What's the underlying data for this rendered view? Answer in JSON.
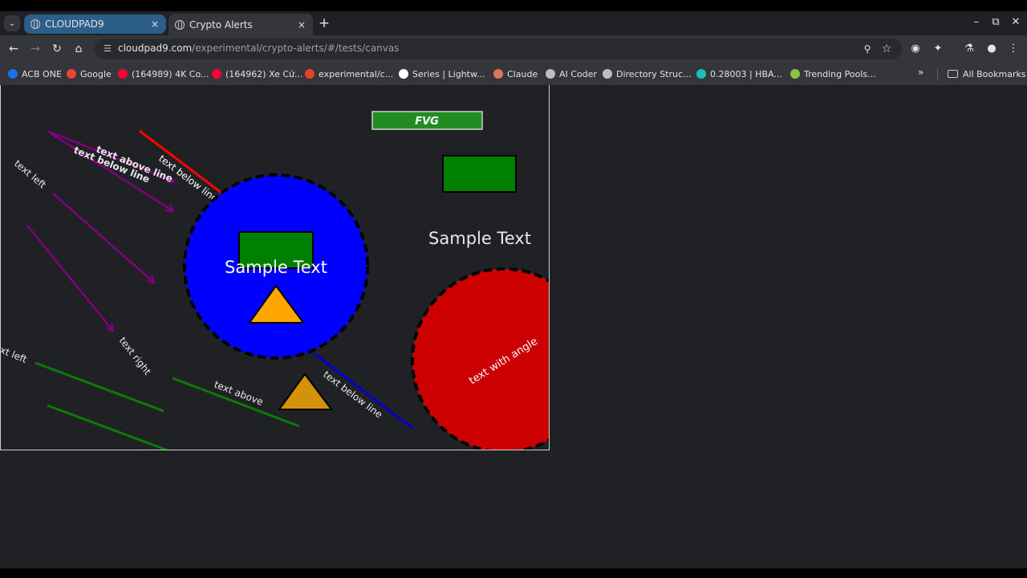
{
  "tabs": [
    {
      "title": "CLOUDPAD9",
      "close": "×"
    },
    {
      "title": "Crypto Alerts",
      "close": "×"
    }
  ],
  "new_tab": "+",
  "window_controls": {
    "minimize": "–",
    "maximize": "⧉",
    "close": "✕"
  },
  "address": {
    "host": "cloudpad9.com",
    "path": "/experimental/crypto-alerts/#/tests/canvas"
  },
  "bookmarks": [
    {
      "label": "ACB ONE",
      "color": "#1a73e8"
    },
    {
      "label": "Google",
      "color": "#ea4335"
    },
    {
      "label": "(164989) 4K Co...",
      "color": "#ff0033"
    },
    {
      "label": "(164962) Xe Cứ...",
      "color": "#ff0033"
    },
    {
      "label": "experimental/c...",
      "color": "#e24329"
    },
    {
      "label": "Series | Lightw...",
      "color": "#ffffff"
    },
    {
      "label": "Claude",
      "color": "#d97757"
    },
    {
      "label": "AI Coder",
      "color": "#bdbdbd"
    },
    {
      "label": "Directory Struc...",
      "color": "#bdbdbd"
    },
    {
      "label": "0.28003 | HBA...",
      "color": "#17c3b2"
    },
    {
      "label": "Trending Pools...",
      "color": "#8bc34a"
    }
  ],
  "bookmarks_more": "»",
  "all_bookmarks": "All Bookmarks",
  "canvas": {
    "badge_label": "FVG",
    "sample_text_1": "Sample Text",
    "sample_text_2": "Sample Text",
    "circle_label": "text with angle",
    "labels": {
      "text_left_1": "text left",
      "text_left_2": "xt left",
      "text_right": "text right",
      "text_above": "text above",
      "text_below_line_1": "text below line",
      "text_below_line_2": "text below line",
      "overlap_a": "text below line",
      "overlap_b": "text above line"
    },
    "colors": {
      "blue_circle": "#0000ff",
      "red_circle": "#cc0000",
      "green_rect": "#008000",
      "triangle": "#ffa500",
      "triangle_dark": "#d4920a",
      "purple": "#800080",
      "red_line": "#ff0000",
      "blue_line": "#0000cc",
      "green_line": "#0a7a0a"
    }
  }
}
